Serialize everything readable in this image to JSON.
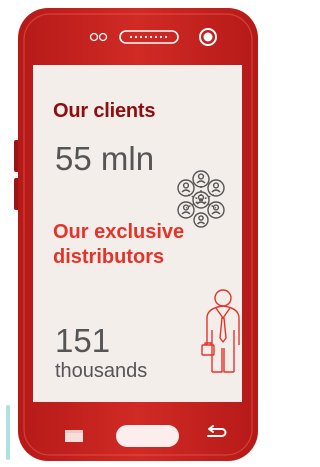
{
  "colors": {
    "phone_body": "#c8221f",
    "phone_dark": "#9a1515",
    "screen": "#f4eeea",
    "clients_title": "#8e0d0d",
    "distributors_title": "#e6332a",
    "value_text": "#555555"
  },
  "clients": {
    "title": "Our clients",
    "value": "55 mln",
    "icon": "people-network-icon"
  },
  "distributors": {
    "title": "Our exclusive distributors",
    "value": "151",
    "unit": "thousands",
    "icon": "businessman-icon"
  },
  "phone": {
    "top_icons": [
      "camera-icon",
      "speaker-grille-icon",
      "front-camera-icon"
    ],
    "bottom_icons": [
      "recent-apps-icon",
      "home-button-icon",
      "back-icon"
    ]
  }
}
